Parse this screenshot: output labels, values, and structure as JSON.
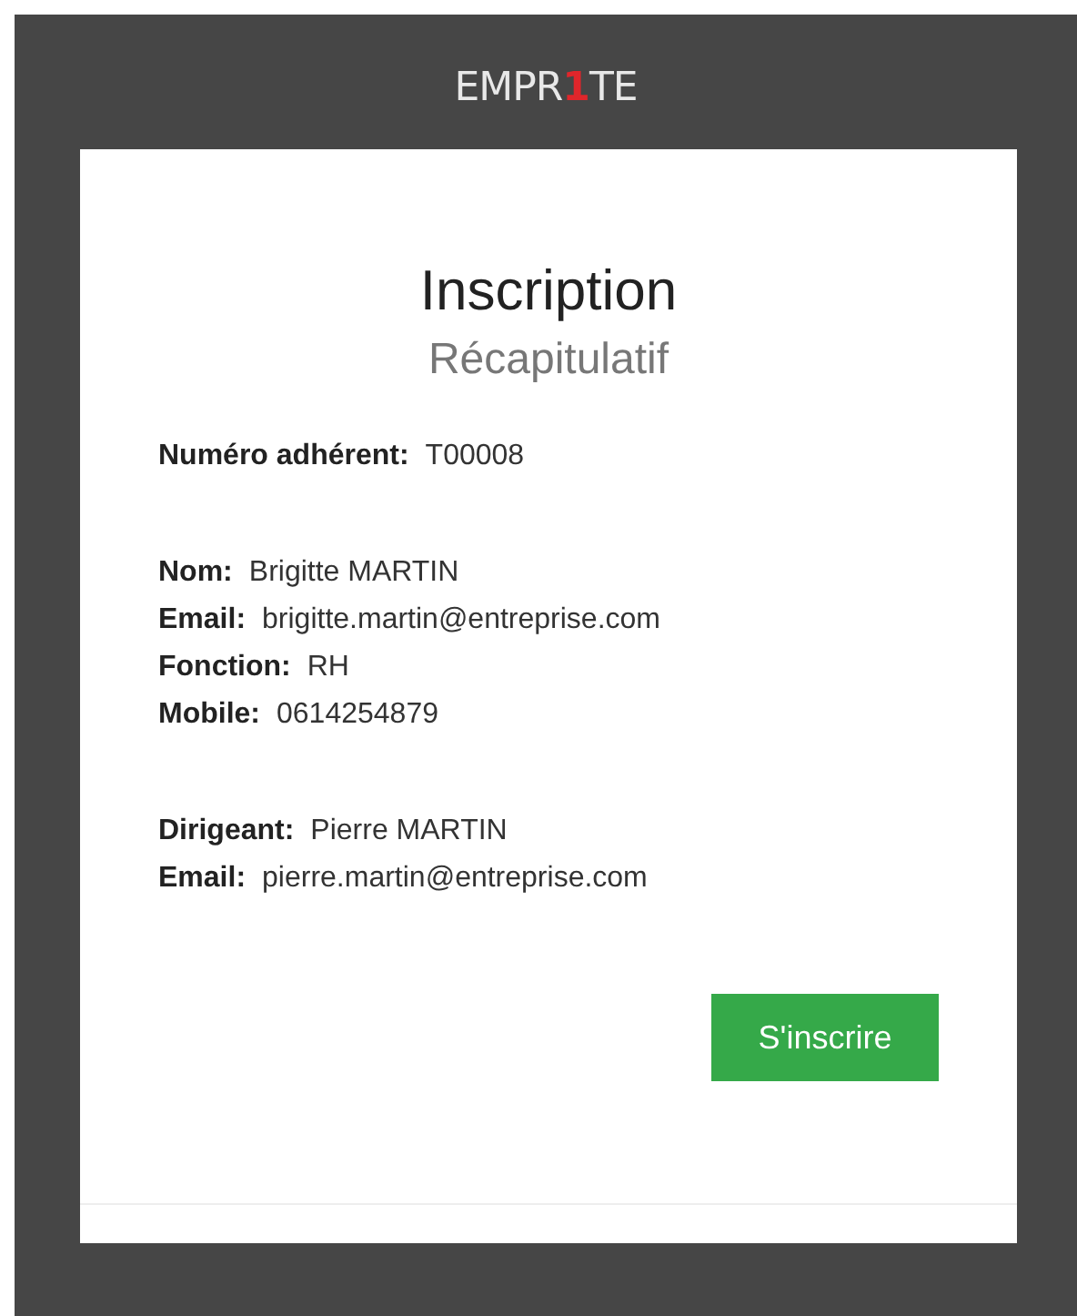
{
  "logo": {
    "parts": [
      {
        "text": "EMPR",
        "accent": false
      },
      {
        "text": "1",
        "accent": true
      },
      {
        "text": "TE",
        "accent": false
      }
    ]
  },
  "title": "Inscription",
  "subtitle": "Récapitulatif",
  "sections": [
    {
      "rows": [
        {
          "label": "Numéro adhérent:",
          "value": "T00008"
        }
      ]
    },
    {
      "rows": [
        {
          "label": "Nom:",
          "value": "Brigitte MARTIN"
        },
        {
          "label": "Email:",
          "value": "brigitte.martin@entreprise.com"
        },
        {
          "label": "Fonction:",
          "value": "RH"
        },
        {
          "label": "Mobile:",
          "value": "0614254879"
        }
      ]
    },
    {
      "rows": [
        {
          "label": "Dirigeant:",
          "value": "Pierre MARTIN"
        },
        {
          "label": "Email:",
          "value": "pierre.martin@entreprise.com"
        }
      ]
    }
  ],
  "submit_button": "S'inscrire"
}
